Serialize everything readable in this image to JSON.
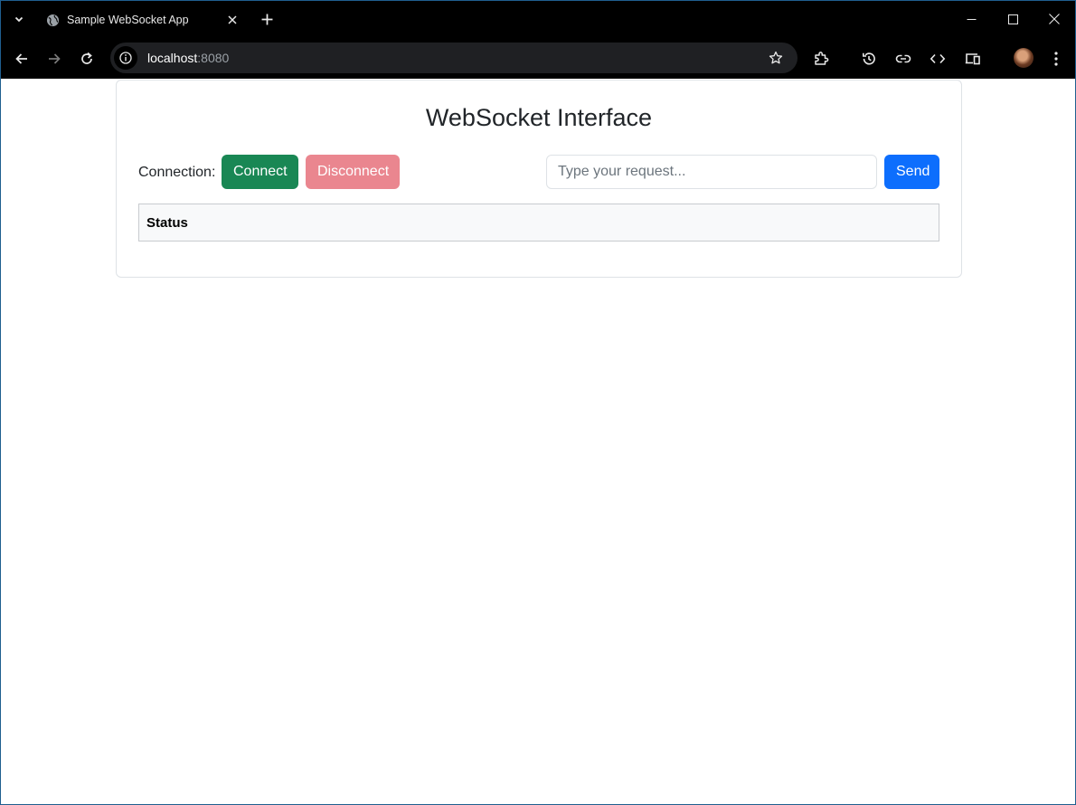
{
  "browser": {
    "tab_title": "Sample WebSocket App",
    "url_host": "localhost",
    "url_port": ":8080"
  },
  "page": {
    "title": "WebSocket Interface",
    "connection_label": "Connection:",
    "connect_label": "Connect",
    "disconnect_label": "Disconnect",
    "request_placeholder": "Type your request...",
    "send_label": "Send",
    "status_header": "Status"
  },
  "colors": {
    "connect": "#198754",
    "disconnect": "#ea868f",
    "send": "#0d6efd"
  }
}
